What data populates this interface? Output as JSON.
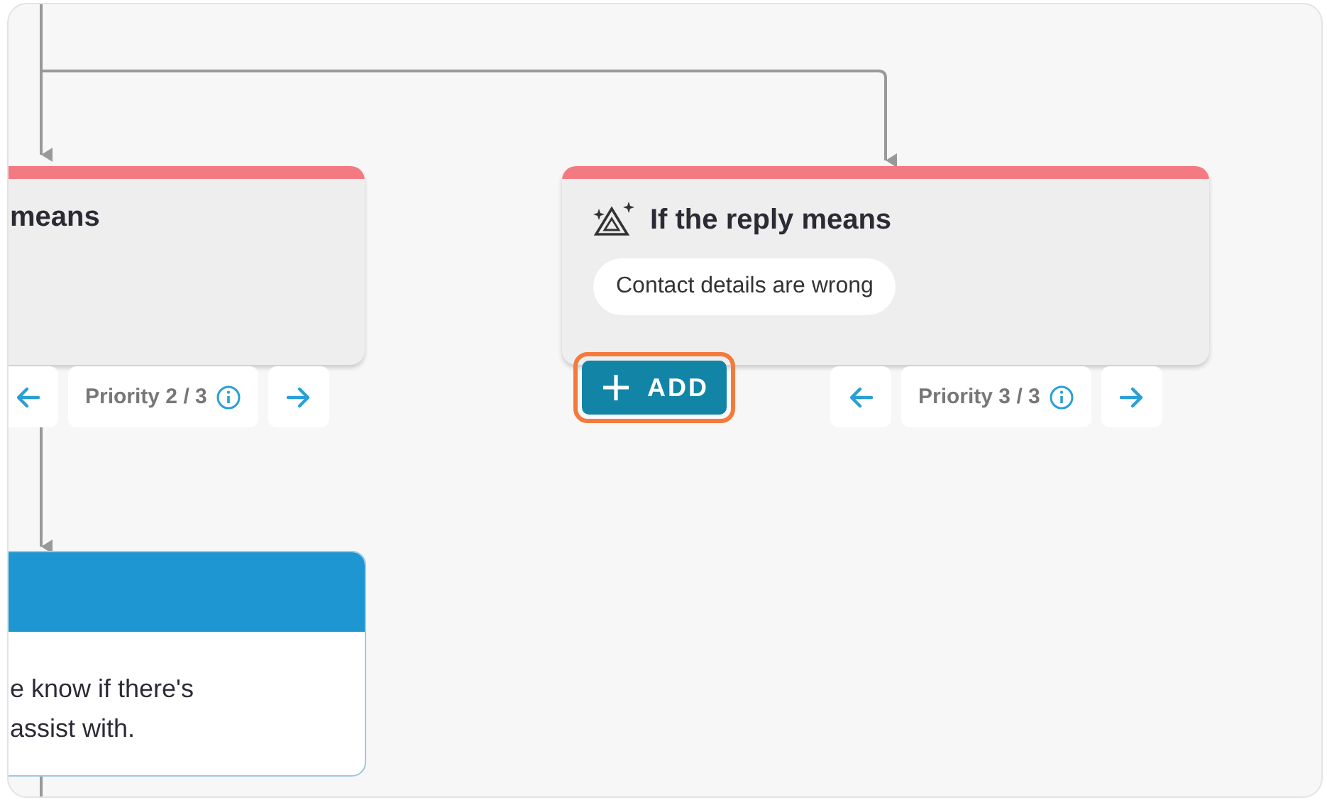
{
  "condition_cards": [
    {
      "title": "means",
      "priority": "Priority 2 / 3"
    },
    {
      "title": "If the reply means",
      "tags": [
        "Contact details are wrong"
      ],
      "priority": "Priority 3 / 3"
    }
  ],
  "add_button": {
    "label": "ADD",
    "focused": true
  },
  "message_card": {
    "lines": [
      "e know if there's",
      "assist with."
    ]
  }
}
